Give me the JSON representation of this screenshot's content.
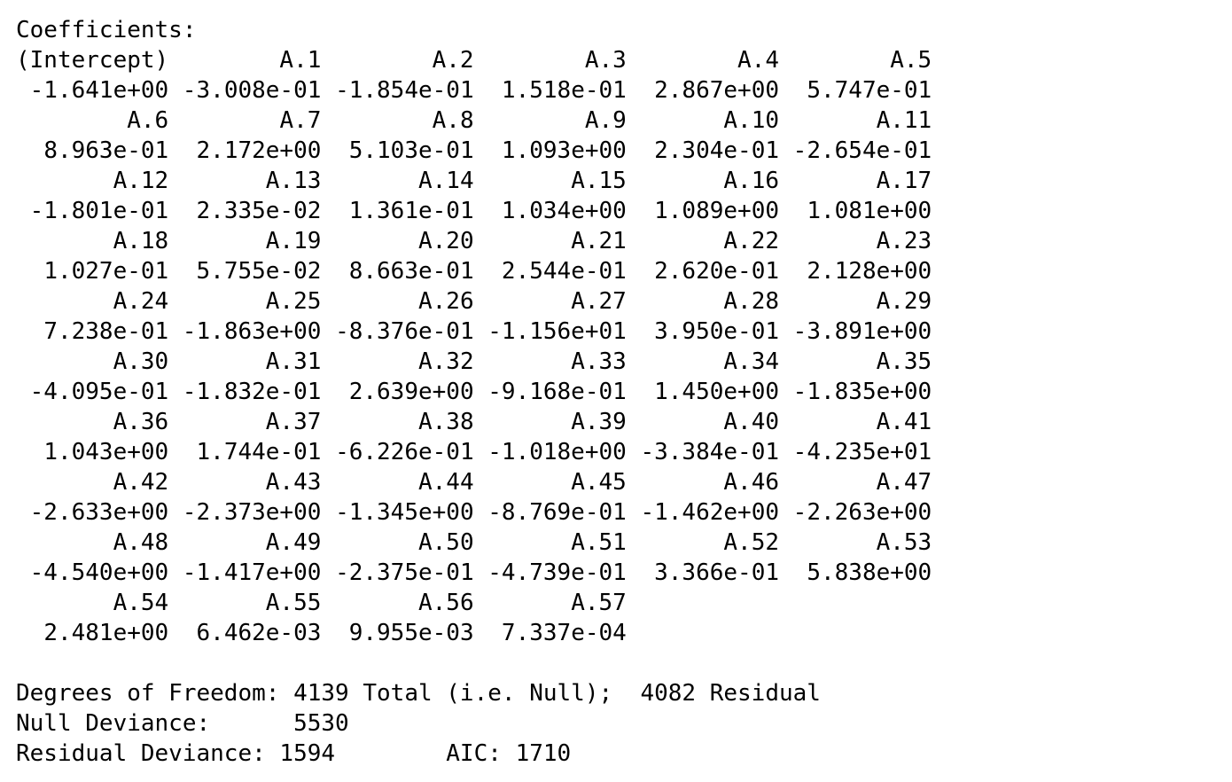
{
  "output": {
    "heading": "Coefficients:",
    "coefficients": [
      {
        "name": "(Intercept)",
        "value": "-1.641e+00"
      },
      {
        "name": "A.1",
        "value": "-3.008e-01"
      },
      {
        "name": "A.2",
        "value": "-1.854e-01"
      },
      {
        "name": "A.3",
        "value": "1.518e-01"
      },
      {
        "name": "A.4",
        "value": "2.867e+00"
      },
      {
        "name": "A.5",
        "value": "5.747e-01"
      },
      {
        "name": "A.6",
        "value": "8.963e-01"
      },
      {
        "name": "A.7",
        "value": "2.172e+00"
      },
      {
        "name": "A.8",
        "value": "5.103e-01"
      },
      {
        "name": "A.9",
        "value": "1.093e+00"
      },
      {
        "name": "A.10",
        "value": "2.304e-01"
      },
      {
        "name": "A.11",
        "value": "-2.654e-01"
      },
      {
        "name": "A.12",
        "value": "-1.801e-01"
      },
      {
        "name": "A.13",
        "value": "2.335e-02"
      },
      {
        "name": "A.14",
        "value": "1.361e-01"
      },
      {
        "name": "A.15",
        "value": "1.034e+00"
      },
      {
        "name": "A.16",
        "value": "1.089e+00"
      },
      {
        "name": "A.17",
        "value": "1.081e+00"
      },
      {
        "name": "A.18",
        "value": "1.027e-01"
      },
      {
        "name": "A.19",
        "value": "5.755e-02"
      },
      {
        "name": "A.20",
        "value": "8.663e-01"
      },
      {
        "name": "A.21",
        "value": "2.544e-01"
      },
      {
        "name": "A.22",
        "value": "2.620e-01"
      },
      {
        "name": "A.23",
        "value": "2.128e+00"
      },
      {
        "name": "A.24",
        "value": "7.238e-01"
      },
      {
        "name": "A.25",
        "value": "-1.863e+00"
      },
      {
        "name": "A.26",
        "value": "-8.376e-01"
      },
      {
        "name": "A.27",
        "value": "-1.156e+01"
      },
      {
        "name": "A.28",
        "value": "3.950e-01"
      },
      {
        "name": "A.29",
        "value": "-3.891e+00"
      },
      {
        "name": "A.30",
        "value": "-4.095e-01"
      },
      {
        "name": "A.31",
        "value": "-1.832e-01"
      },
      {
        "name": "A.32",
        "value": "2.639e+00"
      },
      {
        "name": "A.33",
        "value": "-9.168e-01"
      },
      {
        "name": "A.34",
        "value": "1.450e+00"
      },
      {
        "name": "A.35",
        "value": "-1.835e+00"
      },
      {
        "name": "A.36",
        "value": "1.043e+00"
      },
      {
        "name": "A.37",
        "value": "1.744e-01"
      },
      {
        "name": "A.38",
        "value": "-6.226e-01"
      },
      {
        "name": "A.39",
        "value": "-1.018e+00"
      },
      {
        "name": "A.40",
        "value": "-3.384e-01"
      },
      {
        "name": "A.41",
        "value": "-4.235e+01"
      },
      {
        "name": "A.42",
        "value": "-2.633e+00"
      },
      {
        "name": "A.43",
        "value": "-2.373e+00"
      },
      {
        "name": "A.44",
        "value": "-1.345e+00"
      },
      {
        "name": "A.45",
        "value": "-8.769e-01"
      },
      {
        "name": "A.46",
        "value": "-1.462e+00"
      },
      {
        "name": "A.47",
        "value": "-2.263e+00"
      },
      {
        "name": "A.48",
        "value": "-4.540e+00"
      },
      {
        "name": "A.49",
        "value": "-1.417e+00"
      },
      {
        "name": "A.50",
        "value": "-2.375e-01"
      },
      {
        "name": "A.51",
        "value": "-4.739e-01"
      },
      {
        "name": "A.52",
        "value": "3.366e-01"
      },
      {
        "name": "A.53",
        "value": "5.838e+00"
      },
      {
        "name": "A.54",
        "value": "2.481e+00"
      },
      {
        "name": "A.55",
        "value": "6.462e-03"
      },
      {
        "name": "A.56",
        "value": "9.955e-03"
      },
      {
        "name": "A.57",
        "value": "7.337e-04"
      }
    ],
    "dof_label": "Degrees of Freedom:",
    "dof_total": "4139",
    "dof_total_label": "Total (i.e. Null);",
    "dof_residual": "4082",
    "dof_residual_label": "Residual",
    "null_deviance_label": "Null Deviance:",
    "null_deviance": "5530",
    "residual_deviance_label": "Residual Deviance:",
    "residual_deviance": "1594",
    "aic_label": "AIC:",
    "aic": "1710"
  }
}
